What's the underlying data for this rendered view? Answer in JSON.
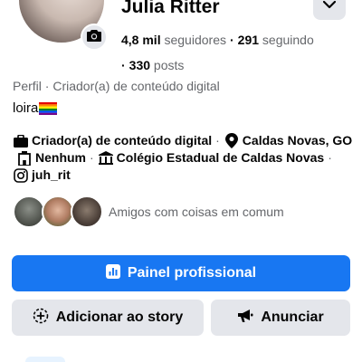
{
  "profile": {
    "name": "Julia Ritter",
    "followers_count": "4,8 mil",
    "followers_label": "seguidores",
    "following_count": "291",
    "following_label": "seguindo",
    "posts_count": "330",
    "posts_label": "posts",
    "profile_type": "Perfil · Criador(a) de conteúdo digital",
    "bio": "loira"
  },
  "details": {
    "category": "Criador(a) de conteúdo digital",
    "location": "Caldas Novas, GO",
    "workplace": "Nenhum",
    "school": "Colégio Estadual de Caldas Novas",
    "instagram": "juh_rit"
  },
  "friends": {
    "label": "Amigos com coisas em comum"
  },
  "actions": {
    "primary_label": "Painel profissional",
    "story_label": "Adicionar ao story",
    "ad_label": "Anunciar"
  },
  "colors": {
    "primary_blue": "#1877f2",
    "secondary_gray": "#e4e6eb",
    "muted_text": "#65676b"
  },
  "icons": [
    "camera-icon",
    "chevron-down-icon",
    "briefcase-icon",
    "location-pin-icon",
    "building-icon",
    "school-icon",
    "instagram-icon",
    "dashboard-icon",
    "add-story-icon",
    "megaphone-icon",
    "rainbow-flag-icon"
  ]
}
